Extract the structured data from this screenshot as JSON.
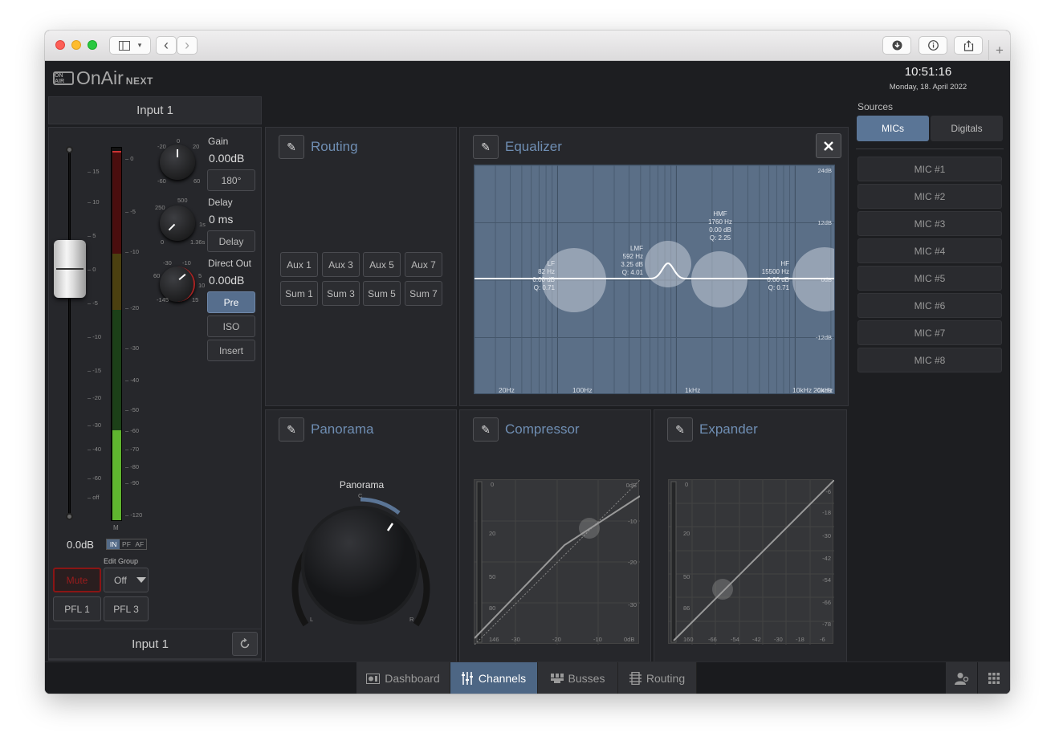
{
  "window": {
    "nav_back": "‹",
    "nav_forward": "›",
    "plus": "+"
  },
  "header": {
    "logo_badge": "ON AIR",
    "logo_main": "OnAir",
    "logo_next": "NEXT",
    "clock": "10:51:16",
    "date": "Monday, 18. April 2022"
  },
  "input_panel": {
    "title": "Input 1",
    "fader_scale": [
      "15",
      "10",
      "5",
      "0",
      "-5",
      "-10",
      "-15",
      "-20",
      "-30",
      "-40",
      "-60",
      "off"
    ],
    "meter_scale": [
      "0",
      "-5",
      "-10",
      "-20",
      "-30",
      "-40",
      "-50",
      "-60",
      "-70",
      "-80",
      "-90",
      "-120"
    ],
    "meter_label": "M",
    "fader_value": "0.0dB",
    "mode_buttons": [
      "IN",
      "PF",
      "AF"
    ],
    "gain": {
      "label": "Gain",
      "value": "0.00dB",
      "phase_button": "180°",
      "ticks": [
        "-20",
        "0",
        "20",
        "-60",
        "60"
      ]
    },
    "delay": {
      "label": "Delay",
      "value": "0 ms",
      "button": "Delay",
      "ticks": [
        "250",
        "500",
        "0",
        "1s",
        "1.36s"
      ]
    },
    "direct_out": {
      "label": "Direct Out",
      "value": "0.00dB",
      "ticks": [
        "-30",
        "-10",
        "60",
        "5",
        "10",
        "-145",
        "15"
      ]
    },
    "buttons": {
      "pre": "Pre",
      "iso": "ISO",
      "insert": "Insert"
    },
    "mute_label": "Mute",
    "edit_group_label": "Edit Group",
    "edit_group_value": "Off",
    "pfl": [
      "PFL 1",
      "PFL 3"
    ],
    "footer_title": "Input 1"
  },
  "routing": {
    "title": "Routing",
    "buttons": [
      "Aux 1",
      "Aux 3",
      "Aux 5",
      "Aux 7",
      "Sum 1",
      "Sum 3",
      "Sum 5",
      "Sum 7"
    ]
  },
  "equalizer": {
    "title": "Equalizer",
    "db_labels": [
      "24dB",
      "12dB",
      "0dB",
      "-12dB",
      "-24dB"
    ],
    "freq_labels": [
      "20Hz",
      "100Hz",
      "1kHz",
      "10kHz",
      "20kHz"
    ],
    "bands": [
      {
        "name": "LF",
        "freq": "82 Hz",
        "gain": "0.00 dB",
        "q": "Q: 0.71"
      },
      {
        "name": "LMF",
        "freq": "592 Hz",
        "gain": "3.25 dB",
        "q": "Q: 4.01"
      },
      {
        "name": "HMF",
        "freq": "1760 Hz",
        "gain": "0.00 dB",
        "q": "Q: 2.25"
      },
      {
        "name": "HF",
        "freq": "15500 Hz",
        "gain": "0.00 dB",
        "q": "Q: 0.71"
      }
    ]
  },
  "panorama": {
    "title": "Panorama",
    "knob_label": "Panorama",
    "c": "C",
    "l": "L",
    "r": "R"
  },
  "compressor": {
    "title": "Compressor",
    "left_scale": [
      "0",
      "20",
      "50",
      "80",
      "146"
    ],
    "right_scale": [
      "0dB",
      "-10",
      "-20",
      "-30"
    ],
    "bottom_scale": [
      "-30",
      "-20",
      "-10",
      "0dB"
    ]
  },
  "expander": {
    "title": "Expander",
    "left_scale": [
      "0",
      "20",
      "50",
      "86",
      "160"
    ],
    "right_scale": [
      "-6",
      "-18",
      "-30",
      "-42",
      "-54",
      "-66",
      "-78"
    ],
    "bottom_scale": [
      "-66",
      "-54",
      "-42",
      "-30",
      "-18",
      "-6"
    ]
  },
  "sources": {
    "title": "Sources",
    "tabs": [
      "MICs",
      "Digitals"
    ],
    "items": [
      "MIC #1",
      "MIC #2",
      "MIC #3",
      "MIC #4",
      "MIC #5",
      "MIC #6",
      "MIC #7",
      "MIC #8"
    ]
  },
  "bottom_tabs": [
    "Dashboard",
    "Channels",
    "Busses",
    "Routing"
  ]
}
